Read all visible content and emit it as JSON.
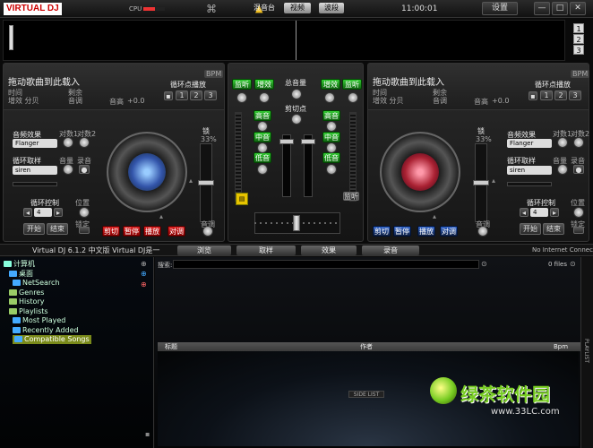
{
  "window": {
    "logo": "VIRTUAL DJ",
    "cpu_label": "CPU",
    "cpu_load": 0.55,
    "clock": "11:00:01",
    "settings_label": "设置",
    "minimize_label": "—",
    "maximize_label": "□",
    "close_label": "✕"
  },
  "waveform": {
    "deck_selectors": [
      "1",
      "2",
      "3"
    ]
  },
  "left_deck": {
    "title": "拖动歌曲到此载入",
    "bpm_badge": "BPM",
    "time_label": "时间",
    "remain_label": "剩余",
    "gain_label": "增效 分贝",
    "key_label": "音调",
    "pitch_label": "音高",
    "pitch_value": "+0.0",
    "loop_label": "循环点播放",
    "loop_btns": [
      "1",
      "2",
      "3"
    ],
    "effect_label": "音频效果",
    "param1_label": "对数1",
    "param2_label": "对数2",
    "effect_value": "Flanger",
    "sampler_label": "循环取样",
    "vol_label": "音量",
    "rec_label": "录音",
    "sampler_value": "siren",
    "loop_ctrl_label": "循环控制",
    "loop_ctrl_value": "4",
    "position_label": "位置",
    "lock_label": "锁定",
    "start_label": "开始",
    "end_label": "结束",
    "pitch_lock_label": "锁",
    "pitch_percent": "33%",
    "tempo_label": "音调",
    "cue_buttons": [
      "剪切",
      "暂停",
      "播放",
      "对调"
    ]
  },
  "right_deck": {
    "title": "拖动歌曲到此载入",
    "bpm_badge": "BPM",
    "time_label": "时间",
    "remain_label": "剩余",
    "gain_label": "增效 分贝",
    "key_label": "音调",
    "pitch_label": "音高",
    "pitch_value": "+0.0",
    "loop_label": "循环点播放",
    "loop_btns": [
      "1",
      "2",
      "3"
    ],
    "effect_label": "音频效果",
    "param1_label": "对数1",
    "param2_label": "对数2",
    "effect_value": "Flanger",
    "sampler_label": "循环取样",
    "vol_label": "音量",
    "rec_label": "录音",
    "sampler_value": "siren",
    "loop_ctrl_label": "循环控制",
    "loop_ctrl_value": "4",
    "position_label": "位置",
    "lock_label": "锁定",
    "start_label": "开始",
    "end_label": "结束",
    "pitch_lock_label": "锁",
    "pitch_percent": "33%",
    "tempo_label": "音调",
    "cue_buttons": [
      "剪切",
      "暂停",
      "播放",
      "对调"
    ]
  },
  "mixer": {
    "tab_mixer": "混音台",
    "tab_video": "视频",
    "tab_scratch": "波段",
    "left_eq": [
      "监听",
      "增效"
    ],
    "right_eq": [
      "增效",
      "监听"
    ],
    "master_label": "总音量",
    "crossfade_label": "剪切点",
    "high_label": "高音",
    "mid_label": "中音",
    "low_label": "低音",
    "listen_label": "监听"
  },
  "status": {
    "version": "Virtual DJ 6.1.2 中文版  Virtual DJ是一",
    "tabs": [
      "浏览",
      "取样",
      "效果",
      "录音"
    ],
    "connection": "No Internet Connection"
  },
  "browser": {
    "folders": [
      {
        "label": "计算机",
        "color": "#8fd"
      },
      {
        "label": "桌面",
        "color": "#4af"
      },
      {
        "label": "NetSearch",
        "color": "#4af"
      },
      {
        "label": "Genres",
        "color": "#9c6"
      },
      {
        "label": "History",
        "color": "#9c6"
      },
      {
        "label": "Playlists",
        "color": "#9c6"
      },
      {
        "label": "Most Played",
        "color": "#4af"
      },
      {
        "label": "Recently Added",
        "color": "#4af"
      },
      {
        "label": "Compatible Songs",
        "color": "#4af"
      }
    ],
    "search_label": "搜索:",
    "file_count": "0 files",
    "columns": [
      "标题",
      "作者",
      "Bpm"
    ],
    "sidelist_label": "SIDE LIST",
    "playlist_label": "PLAYLIST"
  },
  "watermark": {
    "text": "绿茶软件园",
    "url": "www.33LC.com"
  }
}
